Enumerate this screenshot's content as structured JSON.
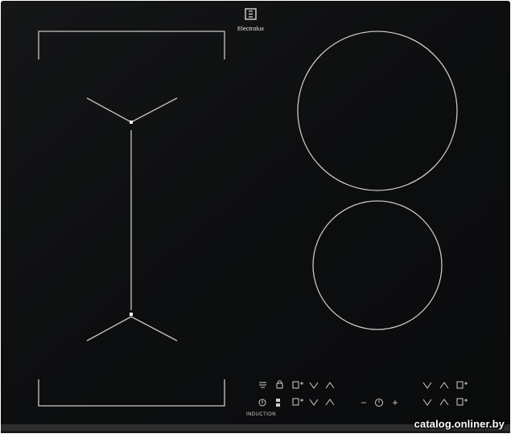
{
  "brand": {
    "name": "Electrolux",
    "logo_icon": "electrolux-logo-icon"
  },
  "panel": {
    "induction_label": "INDUCTION"
  },
  "zones": [
    "bridge-zone-left",
    "round-zone-large",
    "round-zone-small"
  ],
  "controls": {
    "top_row": [
      "hob2hood-icon",
      "lock-icon",
      "power-boost-icon",
      "decrease-chevron-icon",
      "increase-chevron-icon"
    ],
    "bottom_row": [
      "power-icon",
      "bridge-icon",
      "power-boost-icon",
      "decrease-chevron-icon",
      "increase-chevron-icon"
    ],
    "timer": {
      "minus": "−",
      "plus": "+",
      "icon": "timer-icon"
    },
    "right_top": [
      "decrease-chevron-icon",
      "increase-chevron-icon",
      "power-boost-icon"
    ],
    "right_bottom": [
      "decrease-chevron-icon",
      "increase-chevron-icon",
      "power-boost-icon"
    ]
  },
  "colors": {
    "glass": "#0e0f10",
    "lines": "#c7c7c7",
    "frame": "#3a3a3c"
  },
  "watermark": "catalog.onliner.by"
}
